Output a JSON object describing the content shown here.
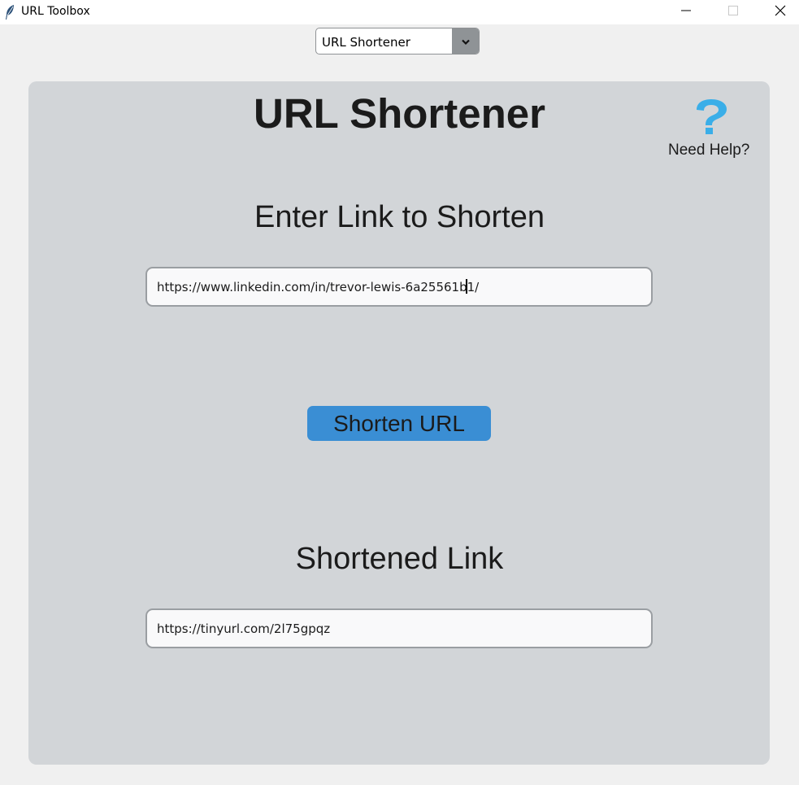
{
  "window": {
    "title": "URL Toolbox",
    "app_icon": "feather-icon",
    "controls": [
      "minimize-icon",
      "maximize-icon",
      "close-icon"
    ]
  },
  "mode_select": {
    "value": "URL Shortener",
    "icon": "chevron-down-icon"
  },
  "main": {
    "title": "URL Shortener",
    "help": {
      "icon": "question-mark-icon",
      "label": "Need Help?",
      "color": "#3aaee8"
    },
    "input_section": {
      "heading": "Enter Link to Shorten",
      "value": "https://www.linkedin.com/in/trevor-lewis-6a25561b1/"
    },
    "button": {
      "label": "Shorten URL",
      "color": "#3a8ed4"
    },
    "output_section": {
      "heading": "Shortened Link",
      "value": "https://tinyurl.com/2l75gpqz"
    }
  }
}
